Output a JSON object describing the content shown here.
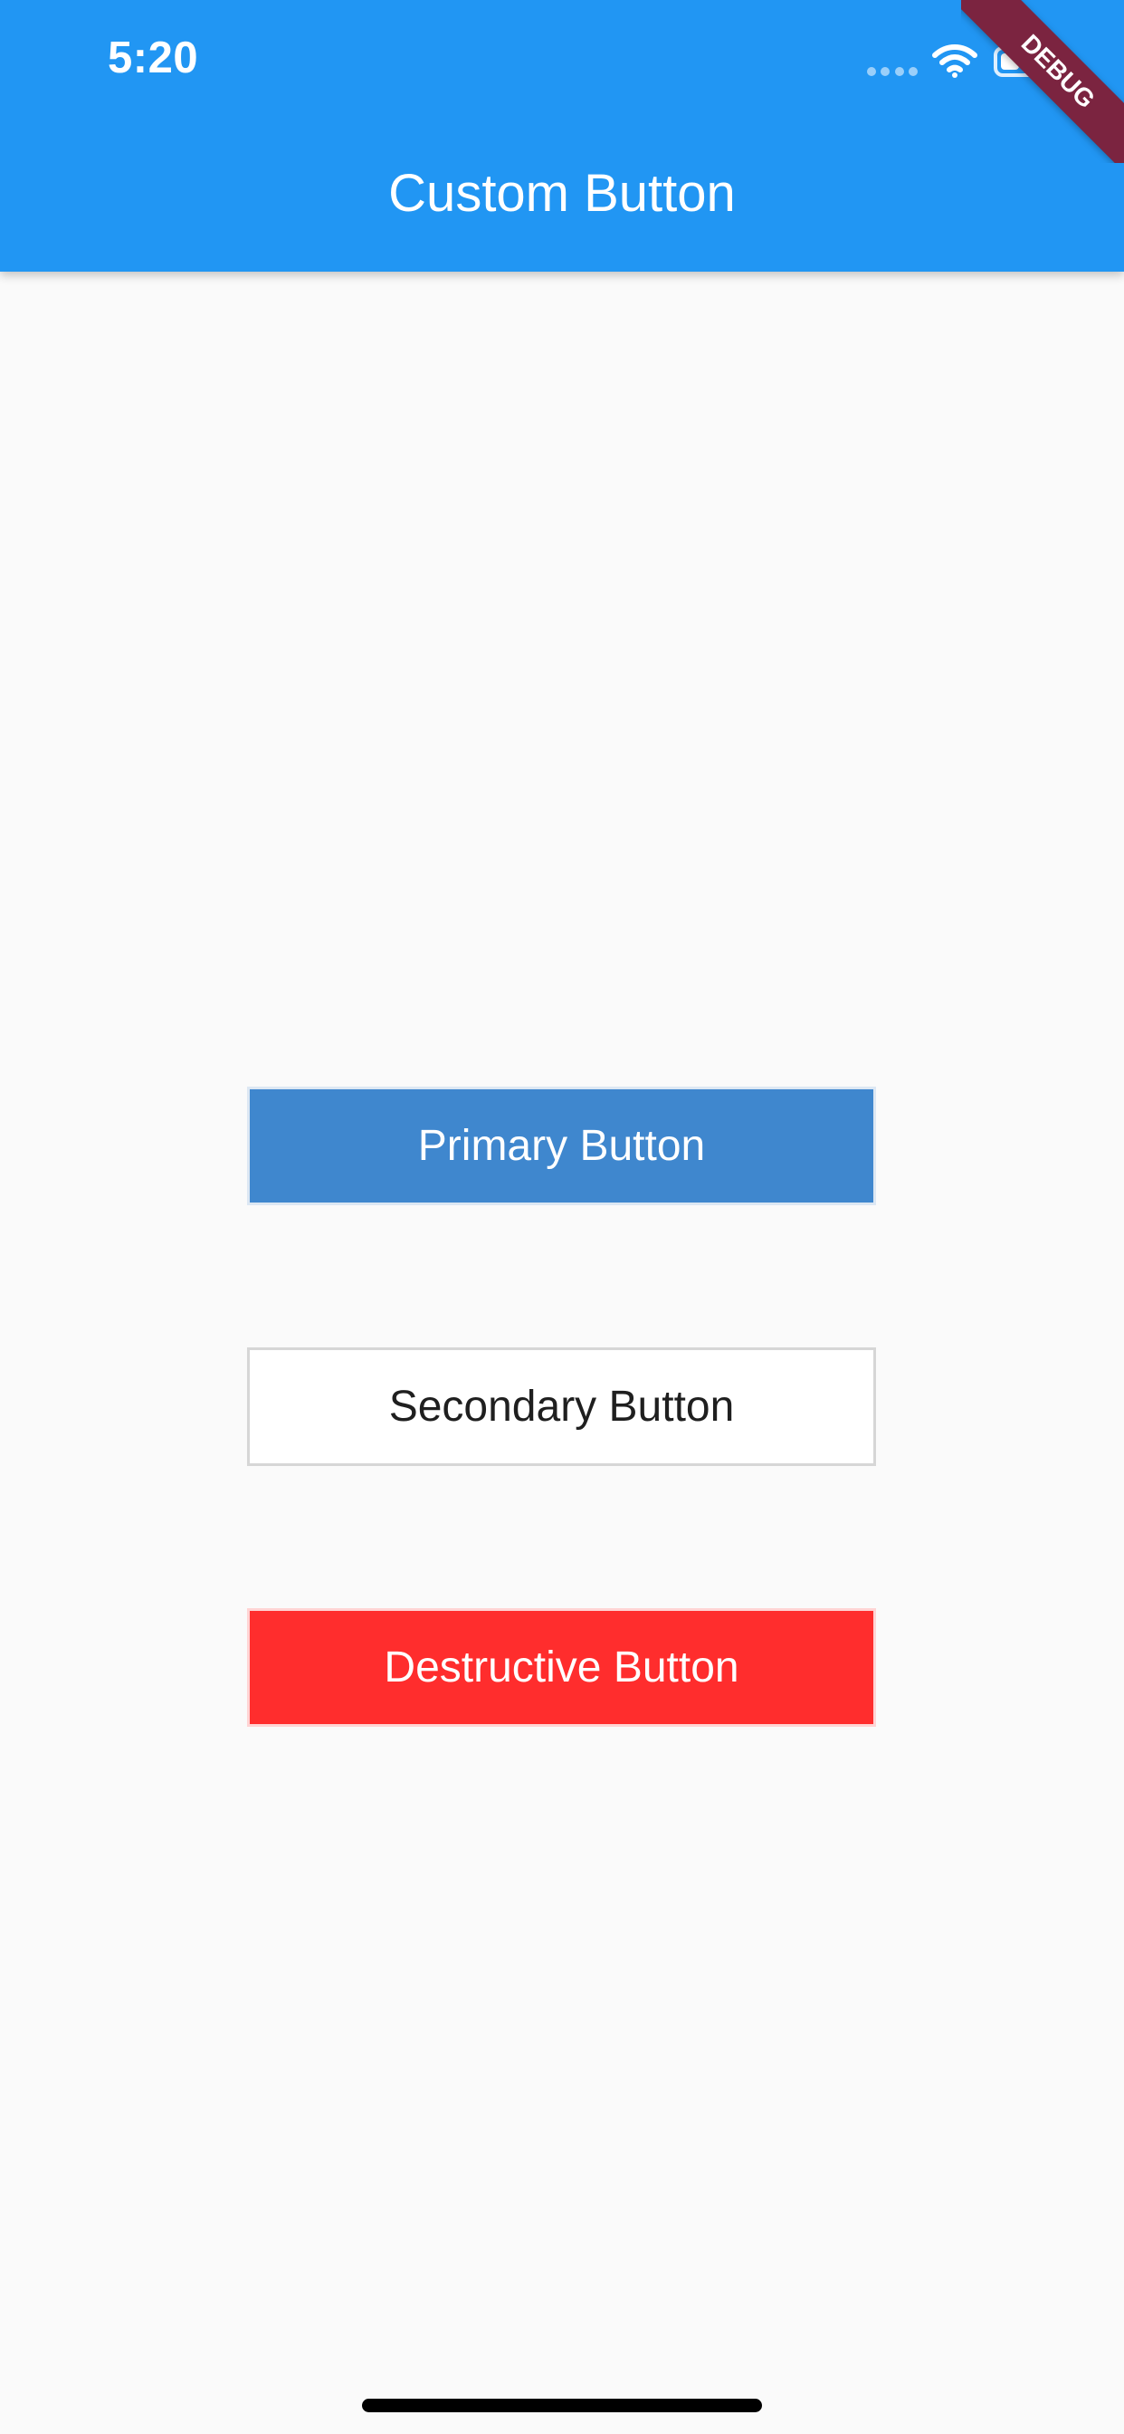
{
  "status_bar": {
    "time": "5:20"
  },
  "app_bar": {
    "title": "Custom Button"
  },
  "debug_banner": {
    "label": "DEBUG"
  },
  "buttons": [
    {
      "label": "Primary Button",
      "background": "#3f87ce",
      "text_color": "#ffffff"
    },
    {
      "label": "Secondary Button",
      "background": "#ffffff",
      "text_color": "#1f1f1f"
    },
    {
      "label": "Destructive Button",
      "background": "#ff2d2d",
      "text_color": "#ffffff"
    }
  ],
  "colors": {
    "app_bar": "#2196f3",
    "page_background": "#fafafa",
    "debug_banner": "#7b2440"
  },
  "icons": {
    "signal": "signal-strength-icon",
    "wifi": "wifi-icon",
    "battery": "battery-icon"
  }
}
